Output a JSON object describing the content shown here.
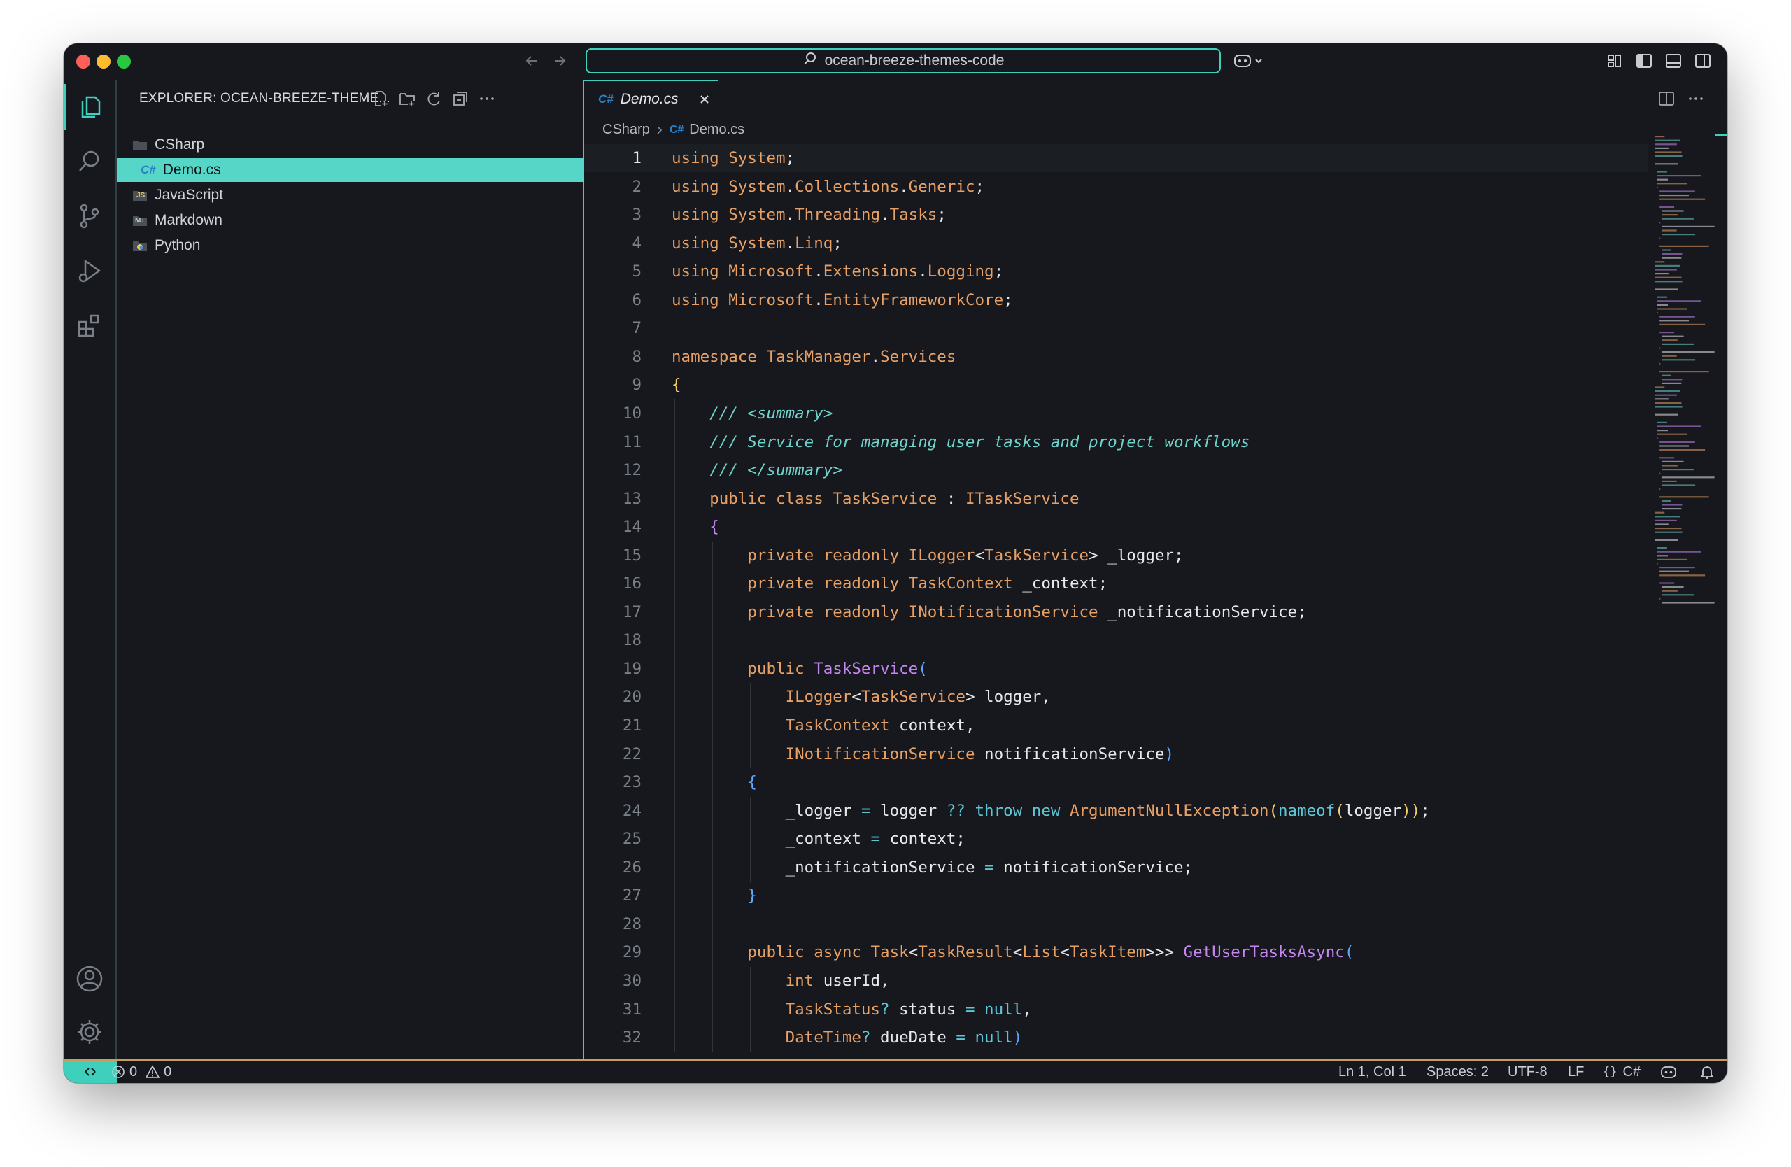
{
  "window": {
    "search_text": "ocean-breeze-themes-code",
    "traffic_colors": [
      "#ff5f57",
      "#febc2e",
      "#28c840"
    ]
  },
  "activity_bar": {
    "items": [
      "explorer-icon",
      "search-icon",
      "source-control-icon",
      "run-debug-icon",
      "extensions-icon"
    ],
    "bottom": [
      "account-icon",
      "settings-gear-icon"
    ]
  },
  "sidebar": {
    "title": "EXPLORER: OCEAN-BREEZE-THEME...",
    "items": [
      {
        "label": "CSharp",
        "icon": "folder-icon"
      },
      {
        "label": "Demo.cs",
        "icon": "csharp-file-icon",
        "badge": "C#"
      },
      {
        "label": "JavaScript",
        "icon": "js-folder-icon",
        "badge": "JS"
      },
      {
        "label": "Markdown",
        "icon": "markdown-folder-icon",
        "badge": "M↓"
      },
      {
        "label": "Python",
        "icon": "python-folder-icon"
      }
    ]
  },
  "editor": {
    "tab": {
      "badge": "C#",
      "label": "Demo.cs"
    },
    "breadcrumb": {
      "folder": "CSharp",
      "badge": "C#",
      "file": "Demo.cs"
    },
    "code_lines": [
      "using System;",
      "using System.Collections.Generic;",
      "using System.Threading.Tasks;",
      "using System.Linq;",
      "using Microsoft.Extensions.Logging;",
      "using Microsoft.EntityFrameworkCore;",
      "",
      "namespace TaskManager.Services",
      "{",
      "    /// <summary>",
      "    /// Service for managing user tasks and project workflows",
      "    /// </summary>",
      "    public class TaskService : ITaskService",
      "    {",
      "        private readonly ILogger<TaskService> _logger;",
      "        private readonly TaskContext _context;",
      "        private readonly INotificationService _notificationService;",
      "",
      "        public TaskService(",
      "            ILogger<TaskService> logger,",
      "            TaskContext context,",
      "            INotificationService notificationService)",
      "        {",
      "            _logger = logger ?? throw new ArgumentNullException(nameof(logger));",
      "            _context = context;",
      "            _notificationService = notificationService;",
      "        }",
      "",
      "        public async Task<TaskResult<List<TaskItem>>> GetUserTasksAsync(",
      "            int userId,",
      "            TaskStatus? status = null,",
      "            DateTime? dueDate = null)"
    ]
  },
  "status_bar": {
    "errors": "0",
    "warnings": "0",
    "position": "Ln 1, Col 1",
    "spaces": "Spaces: 2",
    "encoding": "UTF-8",
    "eol": "LF",
    "language": "C#"
  },
  "colors": {
    "accent": "#3fd0bd",
    "background": "#16181d",
    "keyword": "#e8a065",
    "comment": "#6fd3cb",
    "brace": "#f2cf68",
    "function": "#c586f0"
  }
}
